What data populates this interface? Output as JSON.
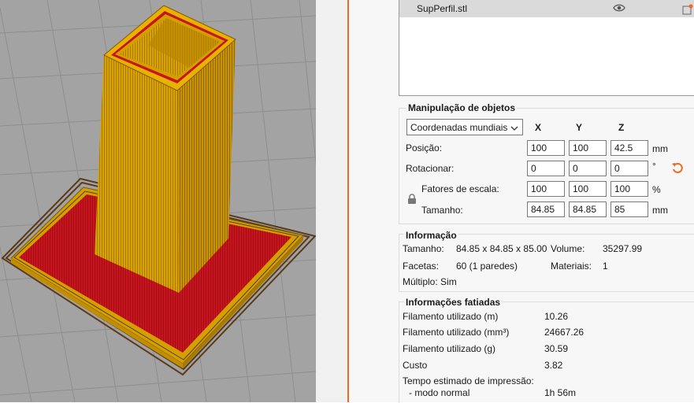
{
  "object_list": {
    "items": [
      {
        "name": "SupPerfil.stl",
        "visible_icon": "eye-icon",
        "edit_icon": "edit-icon"
      }
    ]
  },
  "manipulation": {
    "title": "Manipulação de objetos",
    "coord_select": "Coordenadas mundiais",
    "axes": {
      "x": "X",
      "y": "Y",
      "z": "Z"
    },
    "position": {
      "label": "Posição:",
      "x": "100",
      "y": "100",
      "z": "42.5",
      "unit": "mm"
    },
    "rotation": {
      "label": "Rotacionar:",
      "x": "0",
      "y": "0",
      "z": "0",
      "unit": "°"
    },
    "scale": {
      "label": "Fatores de escala:",
      "x": "100",
      "y": "100",
      "z": "100",
      "unit": "%"
    },
    "size": {
      "label": "Tamanho:",
      "x": "84.85",
      "y": "84.85",
      "z": "85",
      "unit": "mm"
    }
  },
  "info": {
    "title": "Informação",
    "size_label": "Tamanho:",
    "size_value": "84.85 x 84.85 x 85.00",
    "volume_label": "Volume:",
    "volume_value": "35297.99",
    "facets_label": "Facetas:",
    "facets_value": "60 (1 paredes)",
    "materials_label": "Materiais:",
    "materials_value": "1",
    "multiple_label": "Múltiplo: Sim"
  },
  "sliced": {
    "title": "Informações fatiadas",
    "rows": [
      {
        "label": "Filamento utilizado (m)",
        "value": "10.26"
      },
      {
        "label": "Filamento utilizado (mm³)",
        "value": "24667.26"
      },
      {
        "label": "Filamento utilizado (g)",
        "value": "30.59"
      },
      {
        "label": "Custo",
        "value": "3.82"
      }
    ],
    "time_label": "Tempo estimado de impressão:",
    "mode_label": "- modo normal",
    "mode_value": "1h 56m"
  },
  "colors": {
    "accent": "#ed6b21",
    "bed": "#a3a3a3",
    "model": "#d4a000",
    "support": "#c8141e"
  }
}
